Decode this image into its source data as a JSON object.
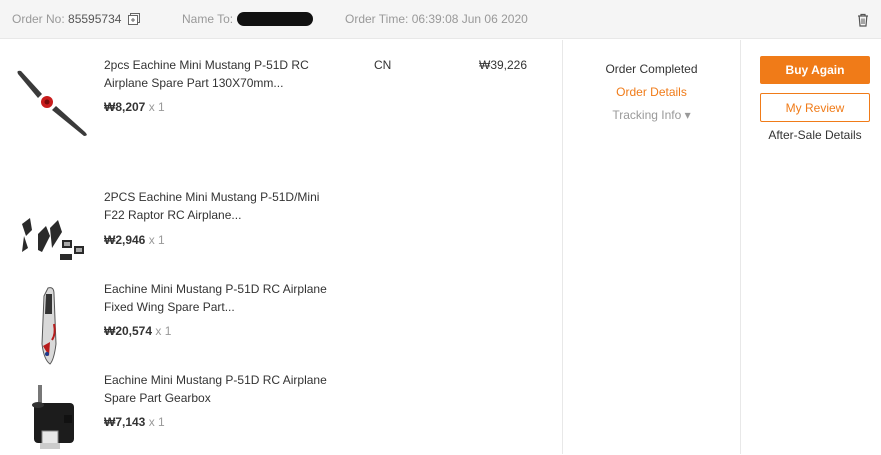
{
  "header": {
    "order_no_label": "Order No:",
    "order_no": "85595734",
    "name_label": "Name To:",
    "order_time_label": "Order Time:",
    "order_time": "06:39:08 Jun 06 2020"
  },
  "order": {
    "country": "CN",
    "total": "₩39,226"
  },
  "items": [
    {
      "title": "2pcs Eachine Mini Mustang P-51D RC Airplane Spare Part 130X70mm...",
      "price": "₩8,207",
      "qty": "x 1",
      "image": "propeller-image"
    },
    {
      "title": "2PCS Eachine Mini Mustang P-51D/Mini F22 Raptor RC Airplane...",
      "price": "₩2,946",
      "qty": "x 1",
      "image": "parts-image"
    },
    {
      "title": "Eachine Mini Mustang P-51D RC Airplane Fixed Wing Spare Part...",
      "price": "₩20,574",
      "qty": "x 1",
      "image": "fuselage-image"
    },
    {
      "title": "Eachine Mini Mustang P-51D RC Airplane Spare Part Gearbox",
      "price": "₩7,143",
      "qty": "x 1",
      "image": "gearbox-image"
    }
  ],
  "status": {
    "state": "Order Completed",
    "details_link": "Order Details",
    "tracking_link": "Tracking Info ▾"
  },
  "actions": {
    "buy_again": "Buy Again",
    "my_review": "My Review",
    "after_sale": "After-Sale Details"
  },
  "colors": {
    "accent": "#f07b18",
    "header_bg": "#f5f5f5",
    "muted_text": "#999999"
  }
}
